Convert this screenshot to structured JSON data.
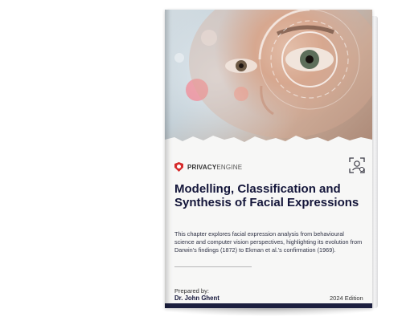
{
  "cover": {
    "brand": {
      "part1": "PRIVACY",
      "part2": "ENGINE"
    },
    "title": "Modelling, Classification and Synthesis of Facial Expressions",
    "description": "This chapter explores facial expression analysis from behavioural science and computer vision perspectives, highlighting its evolution from Darwin's findings (1872) to Ekman et al.'s confirmation (1969).",
    "prepared_label": "Prepared by:",
    "author": "Dr. John Ghent",
    "edition": "2024 Edition"
  },
  "colors": {
    "title": "#14163a",
    "brand_red": "#d62b2b",
    "bar": "#1c1f3f"
  },
  "icons": [
    "privacy-engine-logo-icon",
    "face-scan-icon"
  ]
}
